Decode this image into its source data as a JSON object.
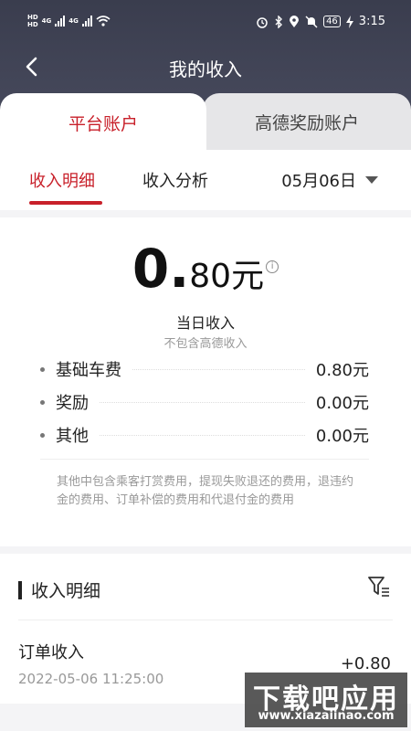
{
  "status_bar": {
    "time": "3:15",
    "battery": "46",
    "hd_top": "HD",
    "hd_bottom": "HD",
    "net1": "4G",
    "net2": "4G"
  },
  "nav": {
    "title": "我的收入"
  },
  "tabs": {
    "left": "平台账户",
    "right": "高德奖励账户"
  },
  "subtabs": {
    "detail": "收入明细",
    "analysis": "收入分析",
    "date": "05月06日"
  },
  "summary": {
    "amount_int": "0.",
    "amount_dec": "80元",
    "info": "i",
    "label": "当日收入",
    "sublabel": "不包含高德收入",
    "rows": [
      {
        "label": "基础车费",
        "value": "0.80元"
      },
      {
        "label": "奖励",
        "value": "0.00元"
      },
      {
        "label": "其他",
        "value": "0.00元"
      }
    ],
    "note": "其他中包含乘客打赏费用，提现失败退还的费用，退违约金的费用、订单补偿的费用和代退付金的费用"
  },
  "detail": {
    "title": "收入明细",
    "items": [
      {
        "name": "订单收入",
        "time": "2022-05-06 11:25:00",
        "amount": "+0.80"
      }
    ]
  },
  "watermark": {
    "big": "下载吧应用",
    "small": "www.xiazaiinao.com"
  },
  "colors": {
    "accent": "#c8202a",
    "header": "#3a3d4e"
  }
}
